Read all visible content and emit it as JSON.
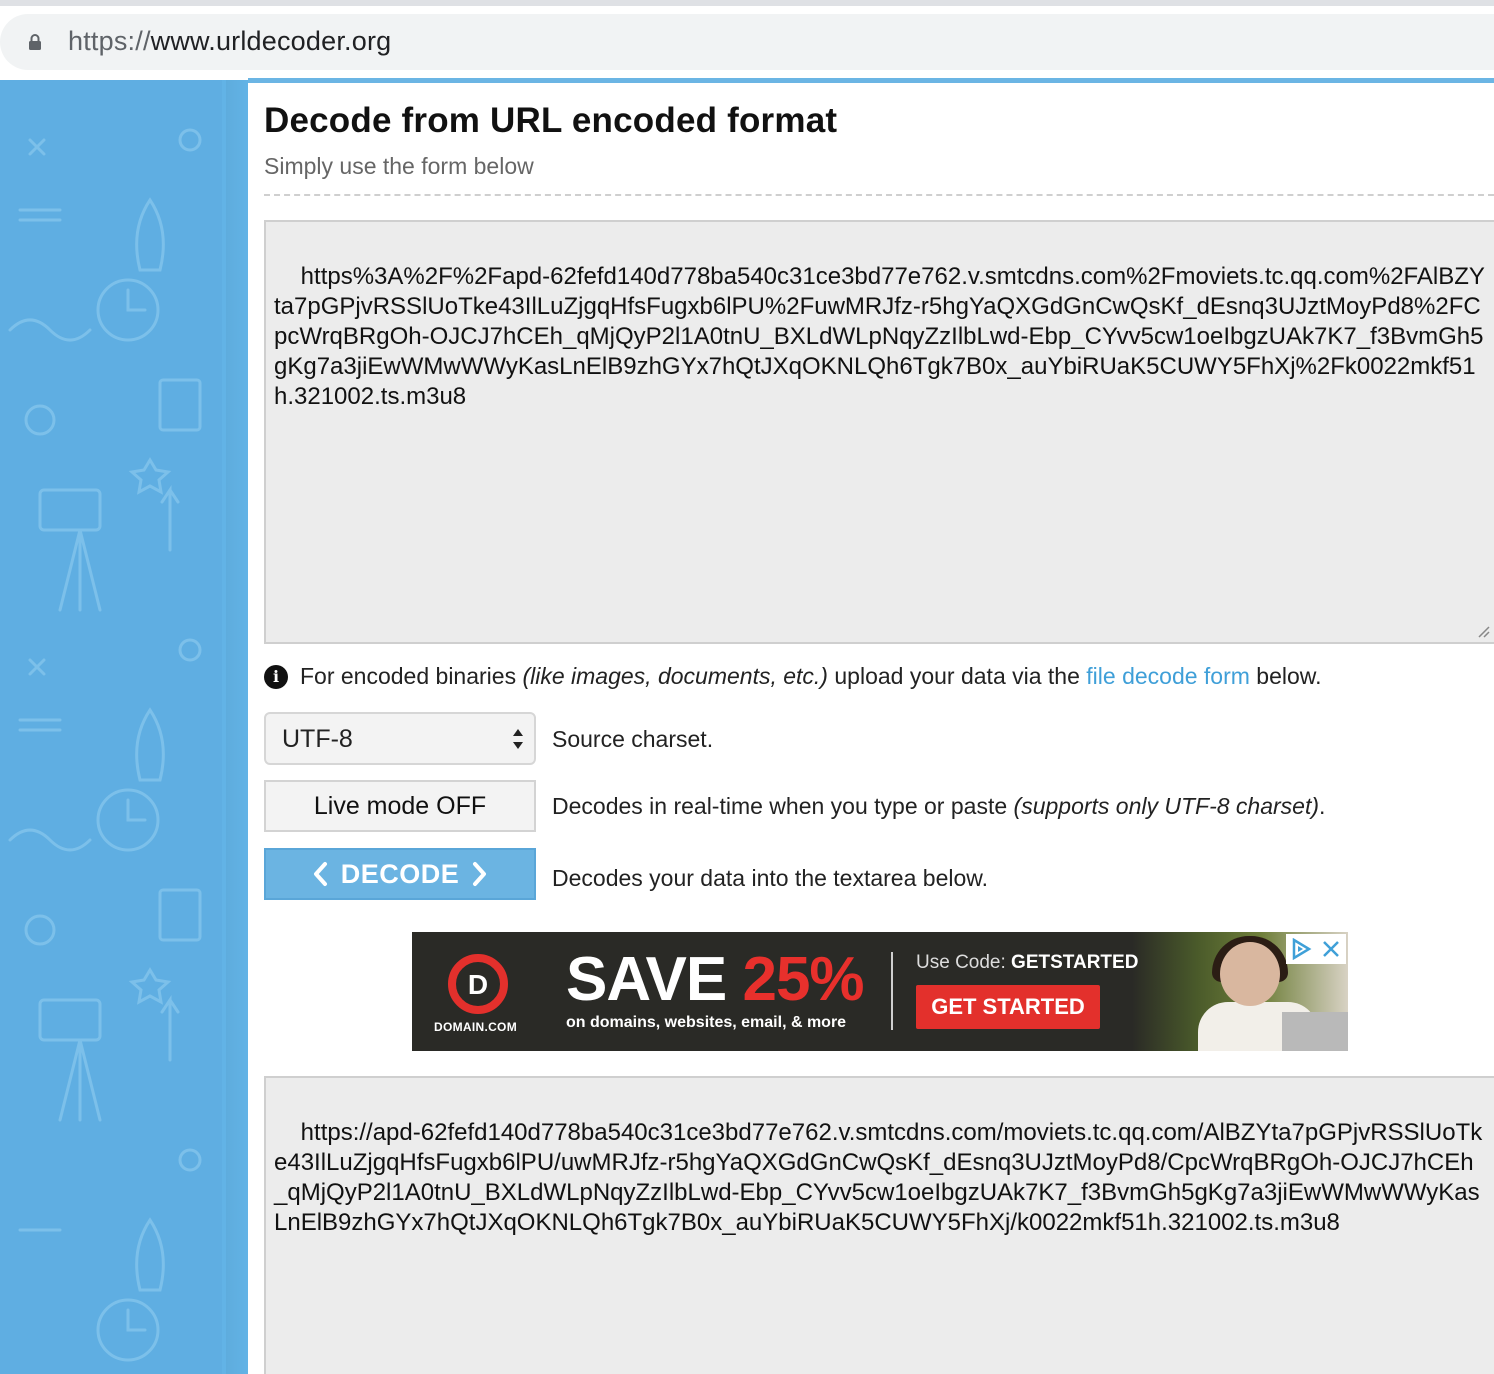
{
  "browser": {
    "url_scheme": "https://",
    "url_host": "www.urldecoder.org"
  },
  "page": {
    "title": "Decode from URL encoded format",
    "subtitle": "Simply use the form below"
  },
  "input": {
    "value": "https%3A%2F%2Fapd-62fefd140d778ba540c31ce3bd77e762.v.smtcdns.com%2Fmoviets.tc.qq.com%2FAlBZYta7pGPjvRSSlUoTke43IlLuZjgqHfsFugxb6lPU%2FuwMRJfz-r5hgYaQXGdGnCwQsKf_dEsnq3UJztMoyPd8%2FCpcWrqBRgOh-OJCJ7hCEh_qMjQyP2l1A0tnU_BXLdWLpNqyZzIlbLwd-Ebp_CYvv5cw1oeIbgzUAk7K7_f3BvmGh5gKg7a3jiEwWMwWWyKasLnElB9zhGYx7hQtJXqOKNLQh6Tgk7B0x_auYbiRUaK5CUWY5FhXj%2Fk0022mkf51h.321002.ts.m3u8"
  },
  "info": {
    "prefix": "For encoded binaries ",
    "italic": "(like images, documents, etc.)",
    "middle": " upload your data via the ",
    "link": "file decode form",
    "suffix": " below."
  },
  "charset": {
    "selected": "UTF-8",
    "label": "Source charset."
  },
  "live_mode": {
    "button": "Live mode OFF",
    "label": "Decodes in real-time when you type or paste ",
    "label_italic": "(supports only UTF-8 charset)",
    "label_end": "."
  },
  "decode": {
    "button": "DECODE",
    "label": "Decodes your data into the textarea below."
  },
  "ad": {
    "logo_text": "DOMAIN.COM",
    "headline": "SAVE ",
    "headline_pct": "25%",
    "sub": "on domains, websites, email, & more",
    "code_prefix": "Use Code: ",
    "code": "GETSTARTED",
    "cta": "GET STARTED"
  },
  "output": {
    "value": "https://apd-62fefd140d778ba540c31ce3bd77e762.v.smtcdns.com/moviets.tc.qq.com/AlBZYta7pGPjvRSSlUoTke43IlLuZjgqHfsFugxb6lPU/uwMRJfz-r5hgYaQXGdGnCwQsKf_dEsnq3UJztMoyPd8/CpcWrqBRgOh-OJCJ7hCEh_qMjQyP2l1A0tnU_BXLdWLpNqyZzIlbLwd-Ebp_CYvv5cw1oeIbgzUAk7K7_f3BvmGh5gKg7a3jiEwWMwWWyKasLnElB9zhGYx7hQtJXqOKNLQh6Tgk7B0x_auYbiRUaK5CUWY5FhXj/k0022mkf51h.321002.ts.m3u8"
  },
  "colors": {
    "accent": "#6bb4e2",
    "sidebar": "#5faee2",
    "link": "#3f9fd8",
    "ad_red": "#e3302c"
  }
}
